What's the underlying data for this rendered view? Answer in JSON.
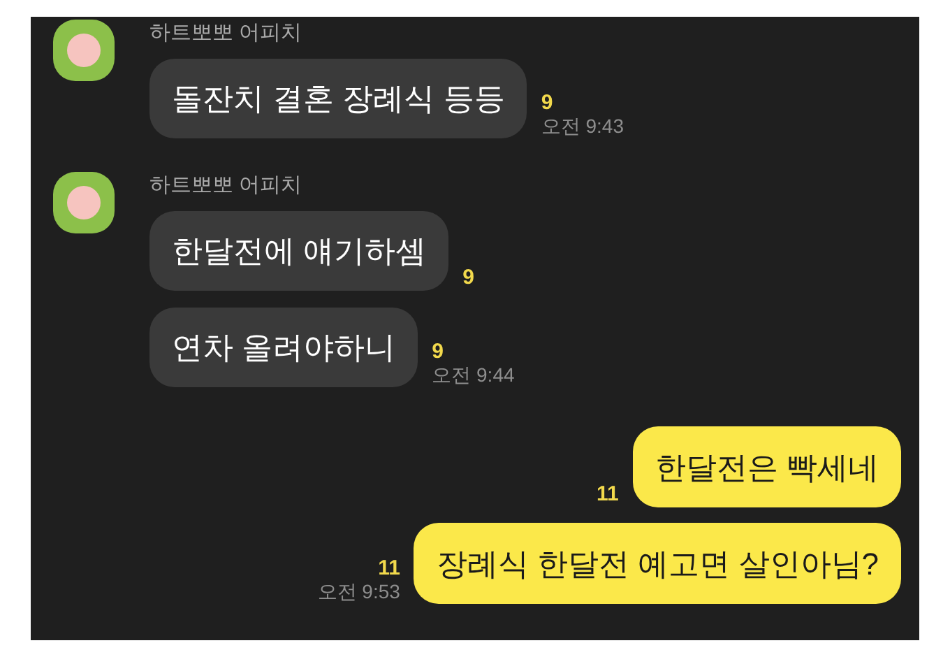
{
  "groups": [
    {
      "kind": "received",
      "sender": "하트뽀뽀 어피치",
      "messages": [
        {
          "text": "돌잔치 결혼 장례식 등등",
          "unread": "9",
          "time": "오전 9:43"
        }
      ]
    },
    {
      "kind": "received",
      "sender": "하트뽀뽀 어피치",
      "messages": [
        {
          "text": "한달전에 얘기하셈",
          "unread": "9"
        },
        {
          "text": "연차 올려야하니",
          "unread": "9",
          "time": "오전 9:44"
        }
      ]
    },
    {
      "kind": "sent",
      "messages": [
        {
          "text": "한달전은 빡세네",
          "unread": "11"
        },
        {
          "text": "장례식 한달전 예고면 살인아님?",
          "unread": "11",
          "time": "오전 9:53"
        }
      ]
    }
  ]
}
